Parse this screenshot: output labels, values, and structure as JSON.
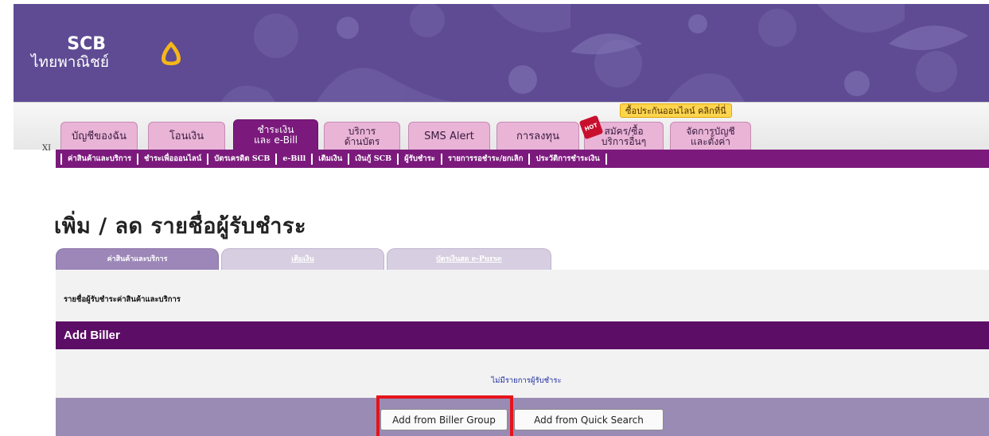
{
  "brand": {
    "name_line1": "SCB",
    "name_line2": "ไทยพาณิชย์",
    "colors": {
      "banner": "#5e4b93",
      "primary": "#7b1a7c",
      "logo_gold": "#f5b719",
      "highlight": "#e5141b"
    }
  },
  "promo": {
    "text": "ซื้อประกันออนไลน์ คลิกที่นี่"
  },
  "tab_bar": {
    "prefix": "XI",
    "tabs": [
      {
        "label": "บัญชีของฉัน"
      },
      {
        "label": "โอนเงิน"
      },
      {
        "label": "ชำระเงิน",
        "label2": "และ e-Bill",
        "active": true
      },
      {
        "label": "บริการ",
        "label2": "ด้านบัตร"
      },
      {
        "label": "SMS Alert"
      },
      {
        "label": "การลงทุน"
      },
      {
        "label": "สมัคร/ซื้อ",
        "label2": "บริการอื่นๆ",
        "badge": "HOT"
      },
      {
        "label": "จัดการบัญชี",
        "label2": "และตั้งค่า"
      }
    ]
  },
  "subnav": {
    "items": [
      "ค่าสินค้าและบริการ",
      "ชำระเพื่อออนไลน์",
      "บัตรเครดิต SCB",
      "e-Bill",
      "เติมเงิน",
      "เงินกู้ SCB",
      "ผู้รับชำระ",
      "รายการรอชำระ/ยกเลิก",
      "ประวัติการชำระเงิน"
    ]
  },
  "page": {
    "title": "เพิ่ม / ลด รายชื่อผู้รับชำระ",
    "sub_tabs": [
      {
        "label": "ค่าสินค้าและบริการ",
        "active": true
      },
      {
        "label": "เติมเงิน"
      },
      {
        "label": "บัตรเงินสด e-Purse"
      }
    ],
    "list_caption": "รายชื่อผู้รับชำระค่าสินค้าและบริการ",
    "section_header": "Add Biller",
    "empty_message": "ไม่มีรายการผู้รับชำระ",
    "buttons": {
      "biller_group": "Add from Biller Group",
      "quick_search": "Add from Quick Search"
    }
  }
}
